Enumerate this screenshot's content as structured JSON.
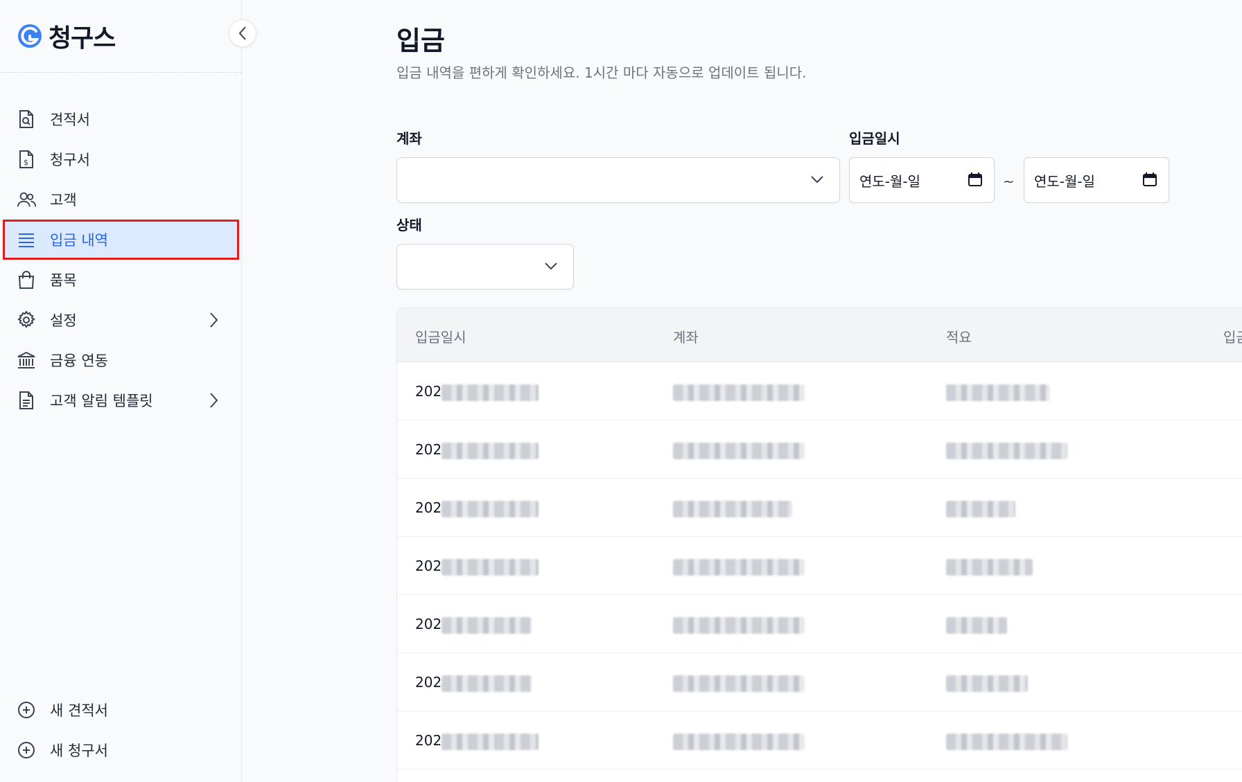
{
  "brand": {
    "name": "청구스",
    "accent": "#2563eb"
  },
  "sidebar": {
    "items": [
      {
        "label": "견적서",
        "icon": "quote-document-icon"
      },
      {
        "label": "청구서",
        "icon": "invoice-dollar-icon"
      },
      {
        "label": "고객",
        "icon": "customers-icon"
      },
      {
        "label": "입금 내역",
        "icon": "list-icon",
        "active": true
      },
      {
        "label": "품목",
        "icon": "shopping-bag-icon"
      },
      {
        "label": "설정",
        "icon": "gear-icon",
        "has_submenu": true
      },
      {
        "label": "금융 연동",
        "icon": "bank-icon"
      },
      {
        "label": "고객 알림 템플릿",
        "icon": "template-document-icon",
        "has_submenu": true
      }
    ],
    "bottom": [
      {
        "label": "새 견적서",
        "icon": "plus-circle-icon"
      },
      {
        "label": "새 청구서",
        "icon": "plus-circle-icon"
      }
    ]
  },
  "page": {
    "title": "입금",
    "subtitle": "입금 내역을 편하게 확인하세요. 1시간 마다 자동으로 업데이트 됩니다."
  },
  "filters": {
    "account_label": "계좌",
    "account_value": "",
    "date_label": "입금일시",
    "date_from_placeholder": "연도-월-일",
    "date_to_placeholder": "연도-월-일",
    "date_separator": "~",
    "status_label": "상태",
    "status_value": ""
  },
  "table": {
    "columns": [
      "입금일시",
      "계좌",
      "적요",
      "입금"
    ],
    "rows": [
      {
        "date": "202"
      },
      {
        "date": "202"
      },
      {
        "date": "202"
      },
      {
        "date": "202"
      },
      {
        "date": "202"
      },
      {
        "date": "202"
      },
      {
        "date": "202"
      }
    ]
  }
}
